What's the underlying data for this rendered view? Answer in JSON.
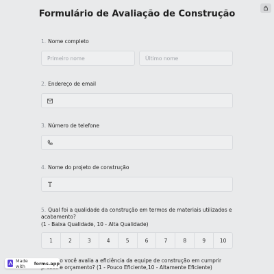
{
  "title": "Formulário de Avaliação de Construção",
  "lock_icon": "lock-icon",
  "questions": [
    {
      "num": "1.",
      "label": "Nome completo",
      "first_placeholder": "Primeiro nome",
      "last_placeholder": "Último nome"
    },
    {
      "num": "2.",
      "label": "Endereço de email",
      "icon": "mail-icon"
    },
    {
      "num": "3.",
      "label": "Número de telefone",
      "icon": "phone-icon"
    },
    {
      "num": "4.",
      "label": "Nome do projeto de construção",
      "icon": "text-icon"
    },
    {
      "num": "5.",
      "label": "Qual foi a qualidade da construção em termos de materiais utilizados e acabamento?",
      "sublabel": "(1 - Baixa Qualidade, 10 - Alta Qualidade)",
      "scale": [
        "1",
        "2",
        "3",
        "4",
        "5",
        "6",
        "7",
        "8",
        "9",
        "10"
      ]
    },
    {
      "num": "6.",
      "label": "Como você avalia a eficiência da equipe de construção em cumprir prazos e orçamento? (1 - Pouco Eficiente,10 - Altamente Eficiente)"
    }
  ],
  "badge": {
    "prefix": "Made with",
    "brand": "forms.app"
  }
}
